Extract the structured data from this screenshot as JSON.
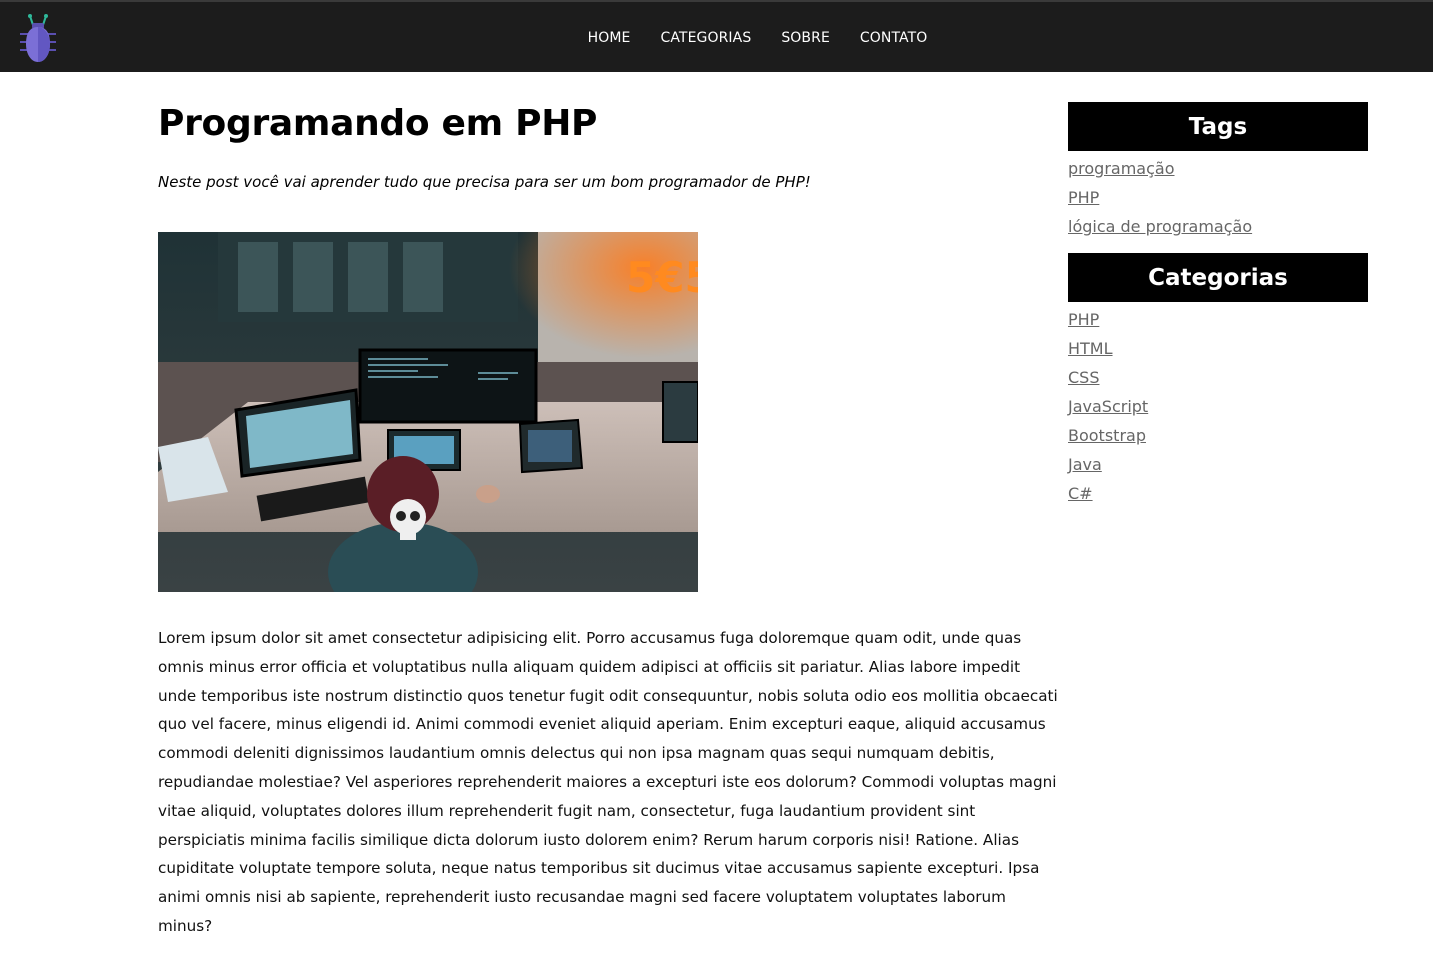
{
  "nav": {
    "logo_icon": "bug-icon",
    "items": [
      "HOME",
      "CATEGORIAS",
      "SOBRE",
      "CONTATO"
    ]
  },
  "post": {
    "title": "Programando em PHP",
    "subtitle": "Neste post você vai aprender tudo que precisa para ser um bom programador de PHP!",
    "image_icon": "photo-hacker-workstation",
    "body": "Lorem ipsum dolor sit amet consectetur adipisicing elit. Porro accusamus fuga doloremque quam odit, unde quas omnis minus error officia et voluptatibus nulla aliquam quidem adipisci at officiis sit pariatur. Alias labore impedit unde temporibus iste nostrum distinctio quos tenetur fugit odit consequuntur, nobis soluta odio eos mollitia obcaecati quo vel facere, minus eligendi id. Animi commodi eveniet aliquid aperiam. Enim excepturi eaque, aliquid accusamus commodi deleniti dignissimos laudantium omnis delectus qui non ipsa magnam quas sequi numquam debitis, repudiandae molestiae? Vel asperiores reprehenderit maiores a excepturi iste eos dolorum? Commodi voluptas magni vitae aliquid, voluptates dolores illum reprehenderit fugit nam, consectetur, fuga laudantium provident sint perspiciatis minima facilis similique dicta dolorum iusto dolorem enim? Rerum harum corporis nisi! Ratione. Alias cupiditate voluptate tempore soluta, neque natus temporibus sit ducimus vitae accusamus sapiente excepturi. Ipsa animi omnis nisi ab sapiente, reprehenderit iusto recusandae magni sed facere voluptatem voluptates laborum minus?"
  },
  "sidebar": {
    "tags": {
      "heading": "Tags",
      "items": [
        "programação",
        "PHP",
        "lógica de programação"
      ]
    },
    "categories": {
      "heading": "Categorias",
      "items": [
        "PHP",
        "HTML",
        "CSS",
        "JavaScript",
        "Bootstrap",
        "Java",
        "C#"
      ]
    }
  },
  "colors": {
    "topbar_bg": "#1c1c1c",
    "nav_text": "#ffffff",
    "sidebar_heading_bg": "#000000",
    "sidebar_link": "#666666",
    "logo_body": "#7b6fd6"
  }
}
